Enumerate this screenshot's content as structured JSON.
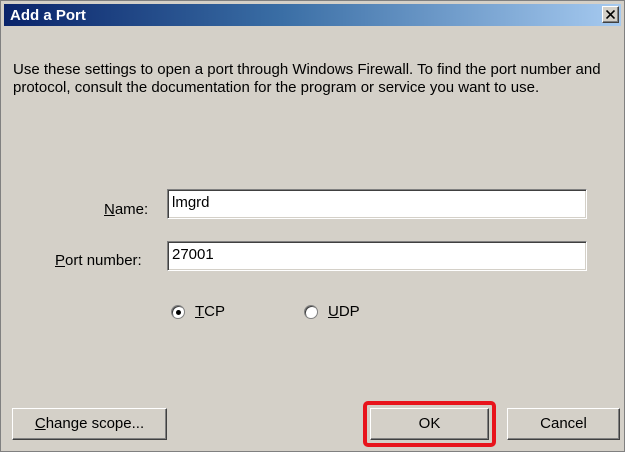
{
  "window": {
    "title": "Add a Port",
    "close_glyph": "×",
    "close_icon": "close-icon"
  },
  "description": "Use these settings to open a port through Windows Firewall. To find the port number and protocol, consult the documentation for the program or service you want to use.",
  "fields": {
    "name": {
      "label_accel": "N",
      "label_rest": "ame:",
      "value": "lmgrd"
    },
    "port": {
      "label_accel": "P",
      "label_rest": "ort number:",
      "value": "27001"
    }
  },
  "protocol": {
    "selected": "TCP",
    "tcp": {
      "accel": "T",
      "rest": "CP"
    },
    "udp": {
      "accel": "U",
      "rest": "DP"
    }
  },
  "buttons": {
    "change_scope": {
      "accel": "C",
      "rest": "hange scope..."
    },
    "ok": "OK",
    "cancel": "Cancel"
  },
  "colors": {
    "dialog_bg": "#d4d0c8",
    "title_start": "#0a246a",
    "title_end": "#a6caf0",
    "highlight": "#e8141c"
  }
}
